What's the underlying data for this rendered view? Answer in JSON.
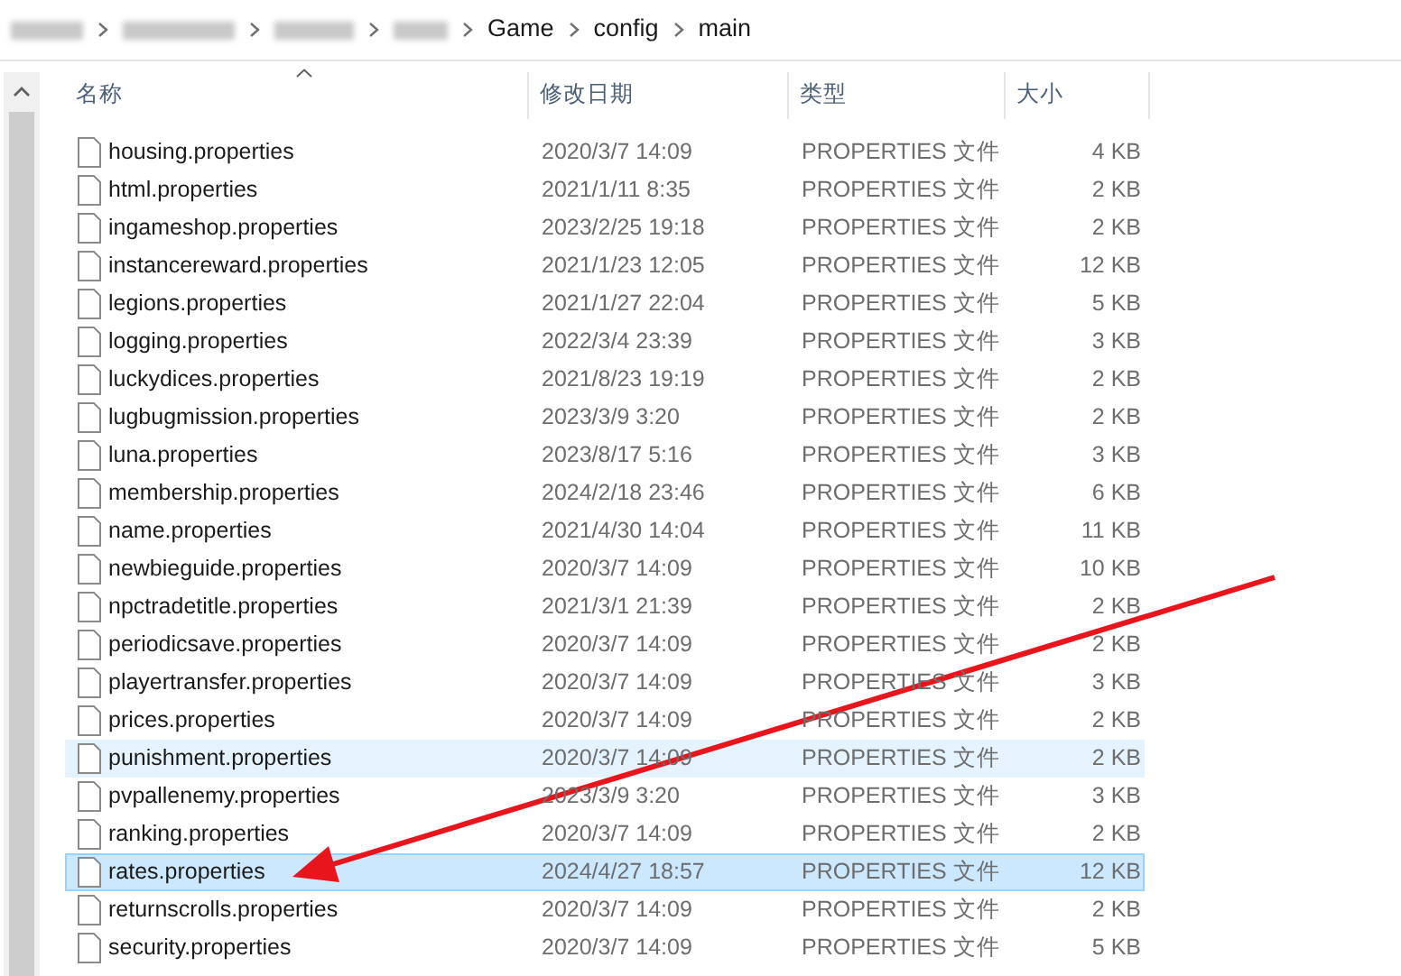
{
  "breadcrumb": [
    "Game",
    "config",
    "main"
  ],
  "columns": [
    {
      "label": "名称",
      "sorted": true
    },
    {
      "label": "修改日期",
      "sorted": false
    },
    {
      "label": "类型",
      "sorted": false
    },
    {
      "label": "大小",
      "sorted": false
    }
  ],
  "files": [
    {
      "name": "housing.properties",
      "date": "2020/3/7 14:09",
      "type": "PROPERTIES 文件",
      "size": "4 KB",
      "selected": false,
      "hovered": false
    },
    {
      "name": "html.properties",
      "date": "2021/1/11 8:35",
      "type": "PROPERTIES 文件",
      "size": "2 KB",
      "selected": false,
      "hovered": false
    },
    {
      "name": "ingameshop.properties",
      "date": "2023/2/25 19:18",
      "type": "PROPERTIES 文件",
      "size": "2 KB",
      "selected": false,
      "hovered": false
    },
    {
      "name": "instancereward.properties",
      "date": "2021/1/23 12:05",
      "type": "PROPERTIES 文件",
      "size": "12 KB",
      "selected": false,
      "hovered": false
    },
    {
      "name": "legions.properties",
      "date": "2021/1/27 22:04",
      "type": "PROPERTIES 文件",
      "size": "5 KB",
      "selected": false,
      "hovered": false
    },
    {
      "name": "logging.properties",
      "date": "2022/3/4 23:39",
      "type": "PROPERTIES 文件",
      "size": "3 KB",
      "selected": false,
      "hovered": false
    },
    {
      "name": "luckydices.properties",
      "date": "2021/8/23 19:19",
      "type": "PROPERTIES 文件",
      "size": "2 KB",
      "selected": false,
      "hovered": false
    },
    {
      "name": "lugbugmission.properties",
      "date": "2023/3/9 3:20",
      "type": "PROPERTIES 文件",
      "size": "2 KB",
      "selected": false,
      "hovered": false
    },
    {
      "name": "luna.properties",
      "date": "2023/8/17 5:16",
      "type": "PROPERTIES 文件",
      "size": "3 KB",
      "selected": false,
      "hovered": false
    },
    {
      "name": "membership.properties",
      "date": "2024/2/18 23:46",
      "type": "PROPERTIES 文件",
      "size": "6 KB",
      "selected": false,
      "hovered": false
    },
    {
      "name": "name.properties",
      "date": "2021/4/30 14:04",
      "type": "PROPERTIES 文件",
      "size": "11 KB",
      "selected": false,
      "hovered": false
    },
    {
      "name": "newbieguide.properties",
      "date": "2020/3/7 14:09",
      "type": "PROPERTIES 文件",
      "size": "10 KB",
      "selected": false,
      "hovered": false
    },
    {
      "name": "npctradetitle.properties",
      "date": "2021/3/1 21:39",
      "type": "PROPERTIES 文件",
      "size": "2 KB",
      "selected": false,
      "hovered": false
    },
    {
      "name": "periodicsave.properties",
      "date": "2020/3/7 14:09",
      "type": "PROPERTIES 文件",
      "size": "2 KB",
      "selected": false,
      "hovered": false
    },
    {
      "name": "playertransfer.properties",
      "date": "2020/3/7 14:09",
      "type": "PROPERTIES 文件",
      "size": "3 KB",
      "selected": false,
      "hovered": false
    },
    {
      "name": "prices.properties",
      "date": "2020/3/7 14:09",
      "type": "PROPERTIES 文件",
      "size": "2 KB",
      "selected": false,
      "hovered": false
    },
    {
      "name": "punishment.properties",
      "date": "2020/3/7 14:09",
      "type": "PROPERTIES 文件",
      "size": "2 KB",
      "selected": false,
      "hovered": true
    },
    {
      "name": "pvpallenemy.properties",
      "date": "2023/3/9 3:20",
      "type": "PROPERTIES 文件",
      "size": "3 KB",
      "selected": false,
      "hovered": false
    },
    {
      "name": "ranking.properties",
      "date": "2020/3/7 14:09",
      "type": "PROPERTIES 文件",
      "size": "2 KB",
      "selected": false,
      "hovered": false
    },
    {
      "name": "rates.properties",
      "date": "2024/4/27 18:57",
      "type": "PROPERTIES 文件",
      "size": "12 KB",
      "selected": true,
      "hovered": false
    },
    {
      "name": "returnscrolls.properties",
      "date": "2020/3/7 14:09",
      "type": "PROPERTIES 文件",
      "size": "2 KB",
      "selected": false,
      "hovered": false
    },
    {
      "name": "security.properties",
      "date": "2020/3/7 14:09",
      "type": "PROPERTIES 文件",
      "size": "5 KB",
      "selected": false,
      "hovered": false
    }
  ]
}
